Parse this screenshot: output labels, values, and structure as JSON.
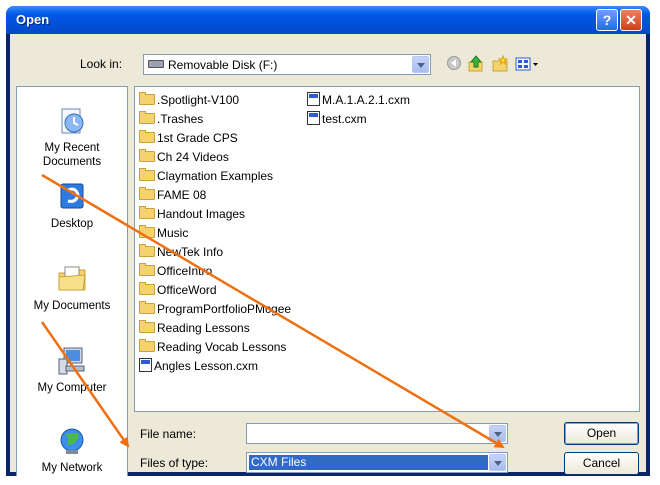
{
  "window": {
    "title": "Open",
    "help_glyph": "?",
    "close_glyph": "✕"
  },
  "lookin": {
    "label": "Look in:",
    "value": "Removable Disk (F:)",
    "icon": "removable-disk-icon"
  },
  "toolbar": [
    "back-icon",
    "up-folder-icon",
    "new-folder-icon",
    "views-menu-icon"
  ],
  "places": [
    {
      "label": "My Recent Documents",
      "icon": "recent-documents-icon"
    },
    {
      "label": "Desktop",
      "icon": "desktop-icon"
    },
    {
      "label": "My Documents",
      "icon": "my-documents-icon"
    },
    {
      "label": "My Computer",
      "icon": "my-computer-icon"
    },
    {
      "label": "My Network",
      "icon": "my-network-icon"
    }
  ],
  "files_col1": [
    {
      "name": ".Spotlight-V100",
      "type": "folder"
    },
    {
      "name": ".Trashes",
      "type": "folder"
    },
    {
      "name": "1st Grade CPS",
      "type": "folder"
    },
    {
      "name": "Ch 24 Videos",
      "type": "folder"
    },
    {
      "name": "Claymation Examples",
      "type": "folder"
    },
    {
      "name": "FAME 08",
      "type": "folder"
    },
    {
      "name": "Handout Images",
      "type": "folder"
    },
    {
      "name": "Music",
      "type": "folder"
    },
    {
      "name": "NewTek Info",
      "type": "folder"
    },
    {
      "name": "OfficeIntro",
      "type": "folder"
    },
    {
      "name": "OfficeWord",
      "type": "folder"
    },
    {
      "name": "ProgramPortfolioPMcgee",
      "type": "folder"
    },
    {
      "name": "Reading  Lessons",
      "type": "folder"
    },
    {
      "name": "Reading Vocab Lessons",
      "type": "folder"
    },
    {
      "name": "Angles Lesson.cxm",
      "type": "file"
    }
  ],
  "files_col2": [
    {
      "name": "M.A.1.A.2.1.cxm",
      "type": "file"
    },
    {
      "name": "test.cxm",
      "type": "file"
    }
  ],
  "filename": {
    "label": "File name:",
    "value": ""
  },
  "filetype": {
    "label": "Files of type:",
    "value": "CXM Files"
  },
  "buttons": {
    "open": "Open",
    "cancel": "Cancel"
  },
  "annotation": {
    "arrow_color": "#f07010"
  }
}
